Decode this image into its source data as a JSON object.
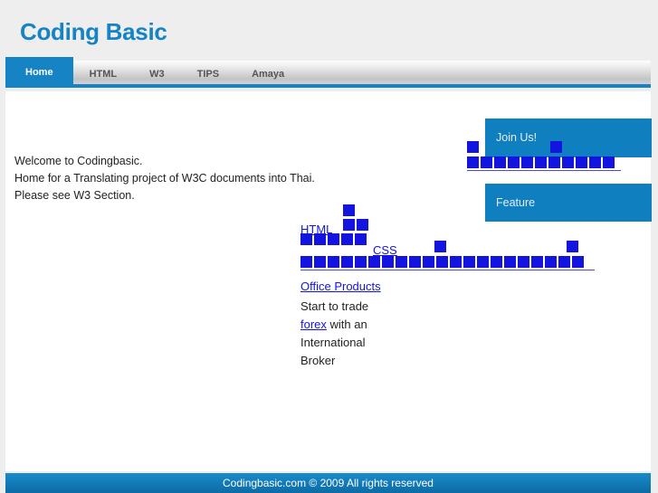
{
  "site": {
    "logo": "Coding Basic",
    "logo_color": "#1583c4"
  },
  "nav": {
    "items": [
      {
        "label": "Home",
        "active": true
      },
      {
        "label": "HTML",
        "active": false
      },
      {
        "label": "W3",
        "active": false
      },
      {
        "label": "TIPS",
        "active": false
      },
      {
        "label": "Amaya",
        "active": false
      }
    ],
    "active_bg": "#1583c4",
    "bar_accent": "#1583c4"
  },
  "main": {
    "welcome_lines": [
      "Welcome to Codingbasic.",
      "Home for a Translating project of W3C documents into Thai.",
      "Please see W3 Section."
    ]
  },
  "promo": {
    "join_us_label": "Join Us!",
    "feature_label": "Feature",
    "box_color": "#0f7fc0"
  },
  "links": {
    "html": "HTML",
    "css": "CSS",
    "office_products": "Office Products",
    "forex": "forex",
    "link_color": "#1414e0"
  },
  "trade": {
    "line1": "Start to trade",
    "line2_before": "",
    "line2_link": "forex",
    "line2_after": " with an",
    "line3": "International",
    "line4": "Broker"
  },
  "glyph_blocks": {
    "note": "unrenderable Thai glyphs shown as solid blue boxes",
    "joinus_top_count": 1,
    "joinus_left_count": 1,
    "joinus_row_count": 11,
    "html_stack_top_count": 1,
    "html_stack_mid_count": 2,
    "html_row_count": 5,
    "css_mid_count": 1,
    "css_far_count": 1,
    "long_row_count": 21
  },
  "footer": {
    "text": "Codingbasic.com © 2009 All rights reserved"
  }
}
